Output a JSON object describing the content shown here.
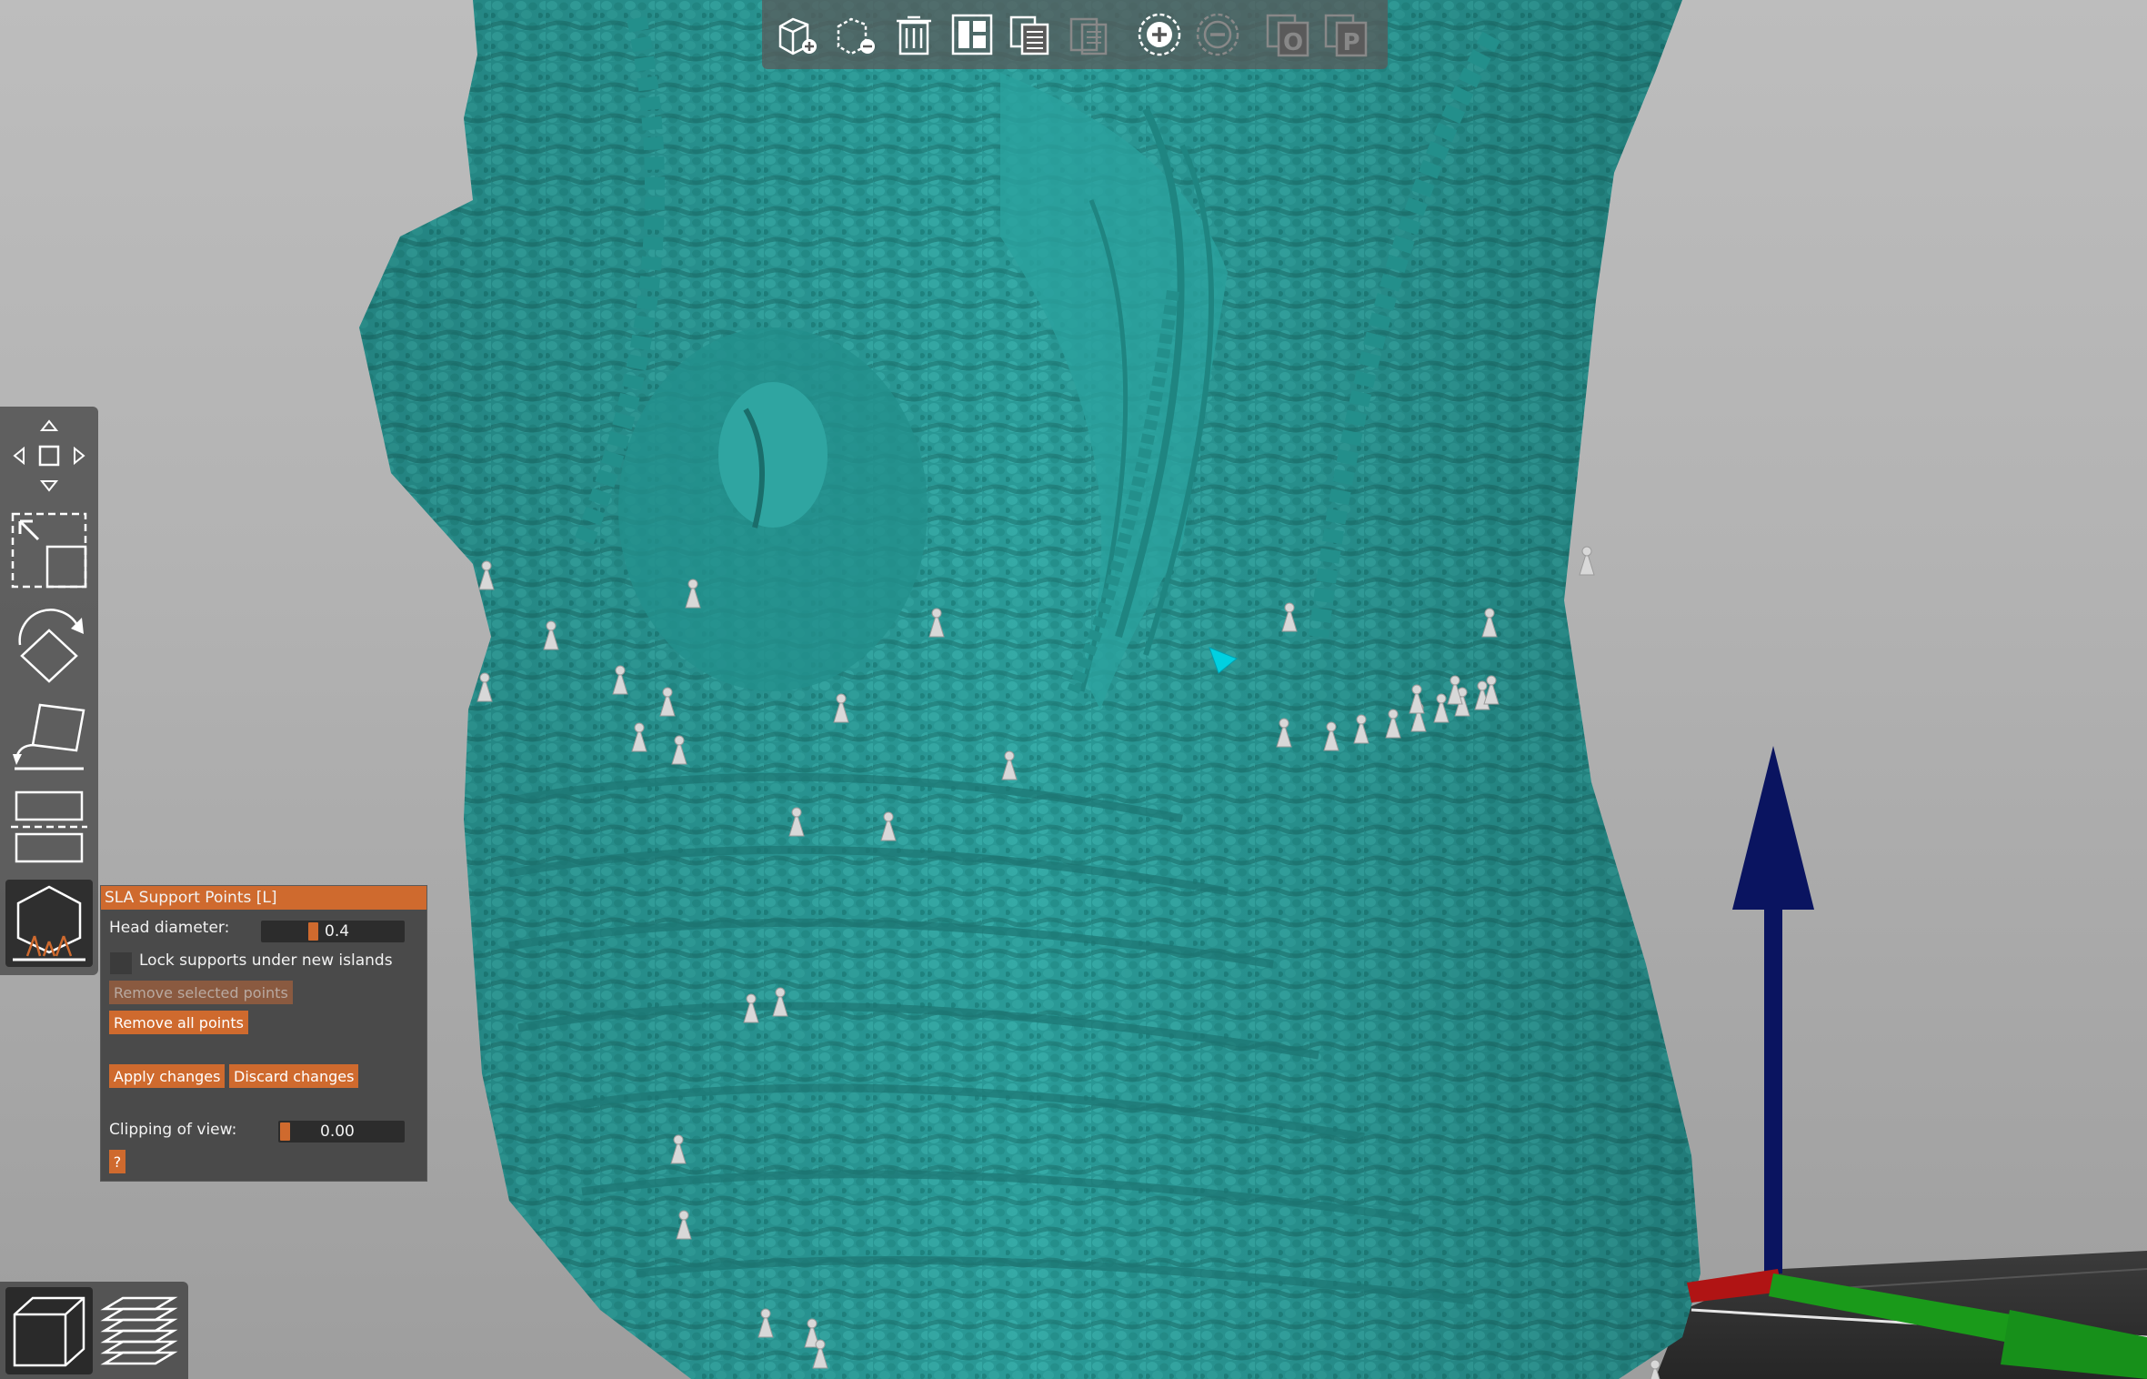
{
  "app": {
    "window_title": ""
  },
  "top_toolbar": {
    "items": [
      {
        "id": "add",
        "icon": "add-object-icon"
      },
      {
        "id": "delete",
        "icon": "delete-object-icon"
      },
      {
        "id": "delete_all",
        "icon": "trash-icon"
      },
      {
        "id": "arrange",
        "icon": "arrange-icon"
      },
      {
        "id": "copy",
        "icon": "copy-icon"
      },
      {
        "id": "paste",
        "icon": "paste-icon"
      },
      {
        "id": "add_instance",
        "icon": "plus-circle-icon"
      },
      {
        "id": "remove_instance",
        "icon": "minus-circle-icon"
      },
      {
        "id": "split_objects",
        "icon": "split-objects-icon",
        "letter": "O"
      },
      {
        "id": "split_parts",
        "icon": "split-parts-icon",
        "letter": "P"
      }
    ]
  },
  "left_toolbar": {
    "items": [
      {
        "id": "move",
        "icon": "move-icon"
      },
      {
        "id": "scale",
        "icon": "scale-icon"
      },
      {
        "id": "rotate",
        "icon": "rotate-icon"
      },
      {
        "id": "place_on_face",
        "icon": "place-on-face-icon"
      },
      {
        "id": "cut",
        "icon": "cut-icon"
      },
      {
        "id": "sla_support_points",
        "icon": "sla-support-points-icon",
        "active": true
      }
    ]
  },
  "sla_panel": {
    "title": "SLA Support Points [L]",
    "head_diameter_label": "Head diameter:",
    "head_diameter_value": "0.4",
    "head_diameter_fraction": 0.35,
    "lock_label": "Lock supports under new islands",
    "lock_checked": false,
    "remove_selected_label": "Remove selected points",
    "remove_all_label": "Remove all points",
    "apply_label": "Apply changes",
    "discard_label": "Discard changes",
    "clipping_label": "Clipping of view:",
    "clipping_value": "0.00",
    "clipping_fraction": 0.0,
    "help_label": "?"
  },
  "view_toolbar": {
    "items": [
      {
        "id": "3d_view",
        "icon": "3d-view-icon",
        "active": true
      },
      {
        "id": "layers_view",
        "icon": "layers-view-icon",
        "active": false
      }
    ]
  },
  "colors": {
    "model": "#2a9a97",
    "model_dark": "#1c7572",
    "accent": "#cf6a2e",
    "panel_bg": "#4a4a4a",
    "z_axis": "#0a1460",
    "x_axis": "#b01414",
    "y_axis": "#1a9a1a",
    "support_point": "#d8d8d8",
    "selected_point": "#00d0e0"
  }
}
